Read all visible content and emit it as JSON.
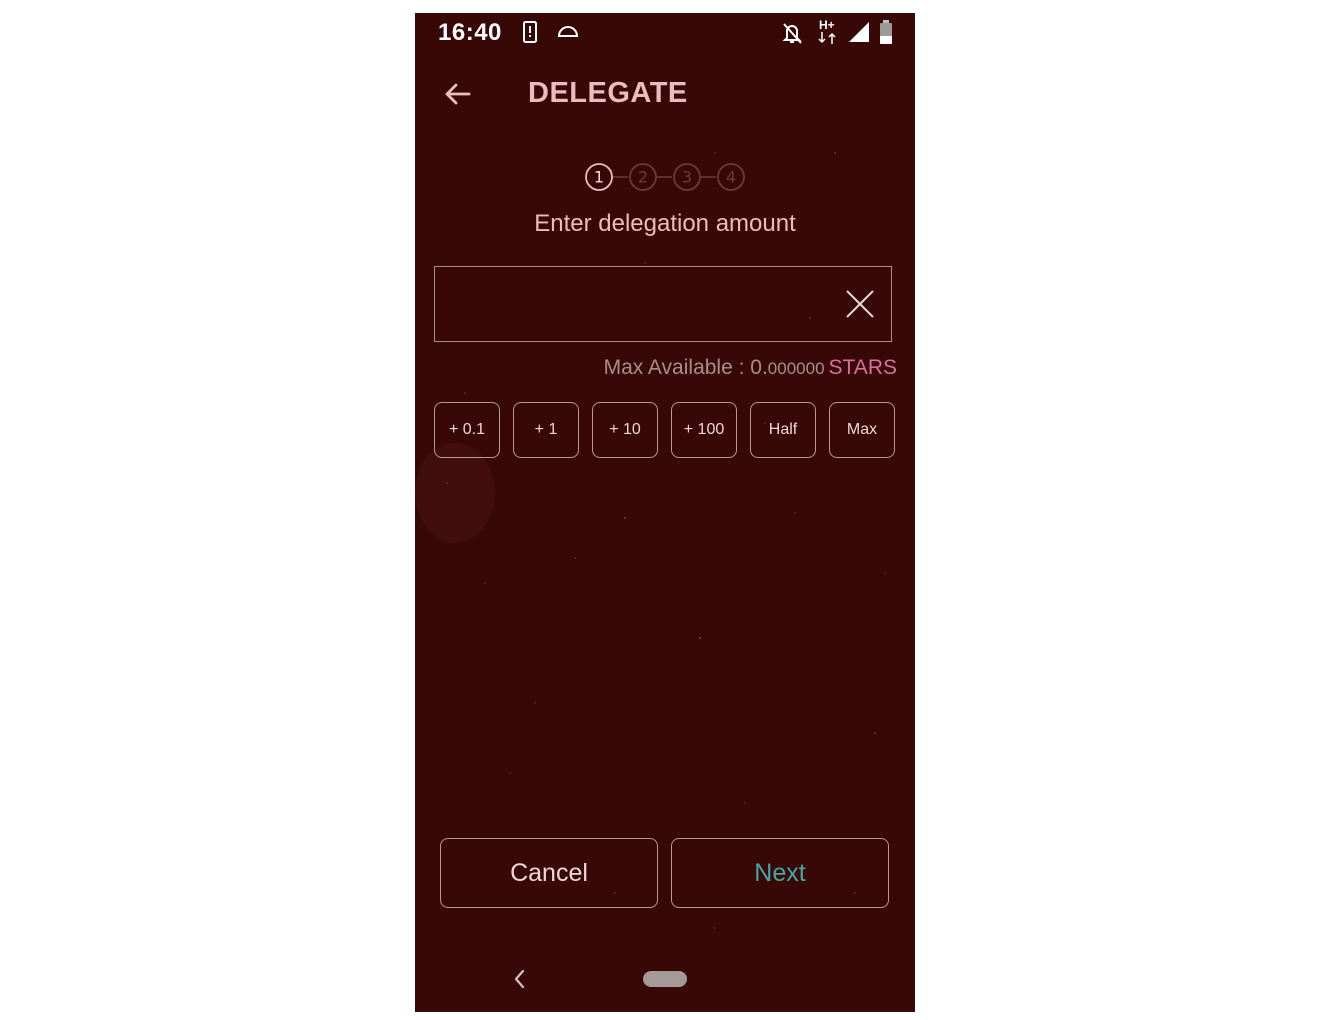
{
  "status_bar": {
    "time": "16:40",
    "left_icons": [
      "device-alert-icon",
      "cloud-arch-icon"
    ],
    "right_icons": [
      "bell-off-icon",
      "hplus-data-icon",
      "signal-icon",
      "battery-icon"
    ],
    "network_label": "H+"
  },
  "header": {
    "back_icon": "arrow-left-icon",
    "title": "DELEGATE"
  },
  "stepper": {
    "steps": [
      "1",
      "2",
      "3",
      "4"
    ],
    "active_step": 1
  },
  "subtitle": "Enter delegation amount",
  "amount_input": {
    "value": "",
    "placeholder": "",
    "clear_icon": "close-x-icon"
  },
  "max_available": {
    "label": "Max Available : ",
    "integer": "0.",
    "decimals": "000000",
    "denom": "STARS"
  },
  "quick_buttons": [
    "+ 0.1",
    "+ 1",
    "+ 10",
    "+ 100",
    "Half",
    "Max"
  ],
  "actions": {
    "cancel": "Cancel",
    "next": "Next"
  },
  "nav_bar": {
    "back_icon": "chevron-left-icon",
    "home_icon": "home-pill-icon"
  },
  "colors": {
    "background": "#380807",
    "title": "#e9bdbd",
    "accent_pink": "#d86fa3",
    "accent_teal": "#44a7a3",
    "border": "#b59a9a"
  }
}
